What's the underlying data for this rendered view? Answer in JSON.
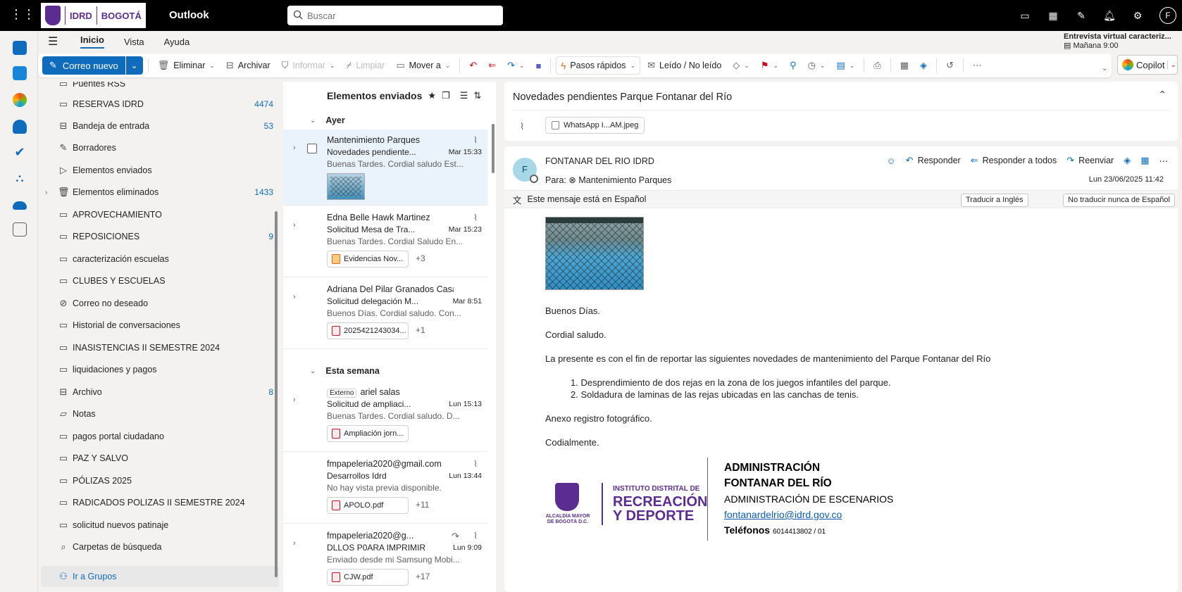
{
  "app": {
    "title": "Outlook"
  },
  "brand": {
    "logo_text_1": "IDRD",
    "logo_text_2": "BOGOTÁ",
    "accent": "#0f6cbd",
    "brand_purple": "#5b2d90"
  },
  "search": {
    "placeholder": "Buscar"
  },
  "avatar": {
    "initial": "F"
  },
  "ribbon": {
    "tabs": [
      "Inicio",
      "Vista",
      "Ayuda"
    ]
  },
  "reminder": {
    "title": "Entrevista virtual caracteriz...",
    "time": "Mañana 9:00"
  },
  "toolbar": {
    "new_mail": "Correo nuevo",
    "delete": "Eliminar",
    "archive": "Archivar",
    "report": "Informar",
    "sweep": "Limpiar",
    "move": "Mover a",
    "quick_steps": "Pasos rápidos",
    "read_unread": "Leído / No leído",
    "copilot": "Copilot"
  },
  "folders": [
    {
      "name": "Puentes RSS",
      "count": "",
      "icon": "folder-icon"
    },
    {
      "name": "RESERVAS IDRD",
      "count": "4474",
      "icon": "folder-icon"
    },
    {
      "name": "Bandeja de entrada",
      "count": "53",
      "icon": "inbox-icon"
    },
    {
      "name": "Borradores",
      "count": "",
      "icon": "drafts-icon"
    },
    {
      "name": "Elementos enviados",
      "count": "",
      "icon": "sent-icon"
    },
    {
      "name": "Elementos eliminados",
      "count": "1433",
      "icon": "trash-icon"
    },
    {
      "name": "APROVECHAMIENTO",
      "count": "",
      "icon": "folder-icon"
    },
    {
      "name": "REPOSICIONES",
      "count": "9",
      "icon": "folder-icon"
    },
    {
      "name": "caracterización escuelas",
      "count": "",
      "icon": "folder-icon"
    },
    {
      "name": "CLUBES Y ESCUELAS",
      "count": "",
      "icon": "folder-icon"
    },
    {
      "name": "Correo no deseado",
      "count": "",
      "icon": "junk-icon"
    },
    {
      "name": "Historial de conversaciones",
      "count": "",
      "icon": "folder-icon"
    },
    {
      "name": "INASISTENCIAS II SEMESTRE 2024",
      "count": "",
      "icon": "folder-icon"
    },
    {
      "name": "liquidaciones y pagos",
      "count": "",
      "icon": "folder-icon"
    },
    {
      "name": "Archivo",
      "count": "8",
      "icon": "archive-icon"
    },
    {
      "name": "Notas",
      "count": "",
      "icon": "notes-icon"
    },
    {
      "name": "pagos portal ciudadano",
      "count": "",
      "icon": "folder-icon"
    },
    {
      "name": "PAZ Y SALVO",
      "count": "",
      "icon": "folder-icon"
    },
    {
      "name": "PÓLIZAS 2025",
      "count": "",
      "icon": "folder-icon"
    },
    {
      "name": "RADICADOS POLIZAS II SEMESTRE 2024",
      "count": "",
      "icon": "folder-icon"
    },
    {
      "name": "solicitud nuevos patinaje",
      "count": "",
      "icon": "folder-icon"
    },
    {
      "name": "Carpetas de búsqueda",
      "count": "",
      "icon": "search-folder-icon"
    },
    {
      "name": "Ir a Grupos",
      "count": "",
      "icon": "groups-icon"
    }
  ],
  "msglist": {
    "title": "Elementos enviados",
    "groups": [
      "Ayer",
      "Esta semana"
    ],
    "messages": [
      {
        "sender": "Mantenimiento Parques",
        "subject": "Novedades pendiente...",
        "time": "Mar 15:33",
        "preview": "Buenas Tardes. Cordial saludo Est...",
        "attachment": "",
        "more": ""
      },
      {
        "sender": "Edna Belle Hawk Martinez",
        "subject": "Solicitud Mesa de Tra...",
        "time": "Mar 15:23",
        "preview": "Buenas Tardes. Cordial Saludo En...",
        "attachment": "Evidencias Nov...",
        "more": "+3"
      },
      {
        "sender": "Adriana Del Pilar Granados Casas",
        "subject": "Solicitud delegación M...",
        "time": "Mar 8:51",
        "preview": "Buenos Días. Cordial saludo. Con...",
        "attachment": "2025421243034...",
        "more": "+1"
      },
      {
        "tag": "Externo",
        "sender": "ariel salas",
        "subject": "Solicitud de ampliaci...",
        "time": "Lun 15:13",
        "preview": "Buenas Tardes. Cordial saludo. D...",
        "attachment": "Ampliación jorn...",
        "more": ""
      },
      {
        "sender": "fmpapeleria2020@gmail.com",
        "subject": "Desarrollos Idrd",
        "time": "Lun 13:44",
        "preview": "No hay vista previa disponible.",
        "attachment": "APOLO.pdf",
        "more": "+11"
      },
      {
        "sender": "fmpapeleria2020@g...",
        "subject": "DLLOS P0ARA IMPRIMIR",
        "time": "Lun 9:09",
        "preview": "Enviado desde mi Samsung Mobi...",
        "attachment": "CJW.pdf",
        "more": "+17"
      }
    ]
  },
  "reading": {
    "subject": "Novedades pendientes Parque Fontanar del Río",
    "attachment": "WhatsApp I...AM.jpeg",
    "avatar_initial": "F",
    "from": "FONTANAR DEL RIO IDRD",
    "to_label": "Para:",
    "to": "Mantenimiento Parques",
    "date": "Lun 23/06/2025 11:42",
    "actions": {
      "reply": "Responder",
      "reply_all": "Responder a todos",
      "forward": "Reenviar"
    },
    "translate": {
      "notice": "Este mensaje está en Español",
      "translate_btn": "Traducir a Inglés",
      "never_btn": "No traducir nunca de Español"
    },
    "body": {
      "greeting": "Buenos Días.",
      "salutation": "Cordial saludo.",
      "intro": "La presente es con el fin de reportar las siguientes novedades de mantenimiento del Parque Fontanar del Río",
      "items": [
        "1. Desprendimiento de dos rejas en la zona de los juegos infantiles del parque.",
        "2. Soldadura de laminas de las rejas ubicadas en las canchas de tenis."
      ],
      "annex": "Anexo registro fotográfico.",
      "closing": "Codialmente."
    },
    "signature": {
      "seal_text": "ALCALDÍA MAYOR DE BOGOTÁ D.C.",
      "inst_line1": "INSTITUTO DISTRITAL DE",
      "inst_line2": "RECREACIÓN",
      "inst_line3": "Y DEPORTE",
      "title1": "ADMINISTRACIÓN",
      "title2": "FONTANAR DEL RÍO",
      "dept": "ADMINISTRACIÓN DE ESCENARIOS",
      "email": "fontanardelrio@idrd.gov.co",
      "phones_label": "Teléfonos",
      "phones": "6014413802 / 01"
    }
  }
}
